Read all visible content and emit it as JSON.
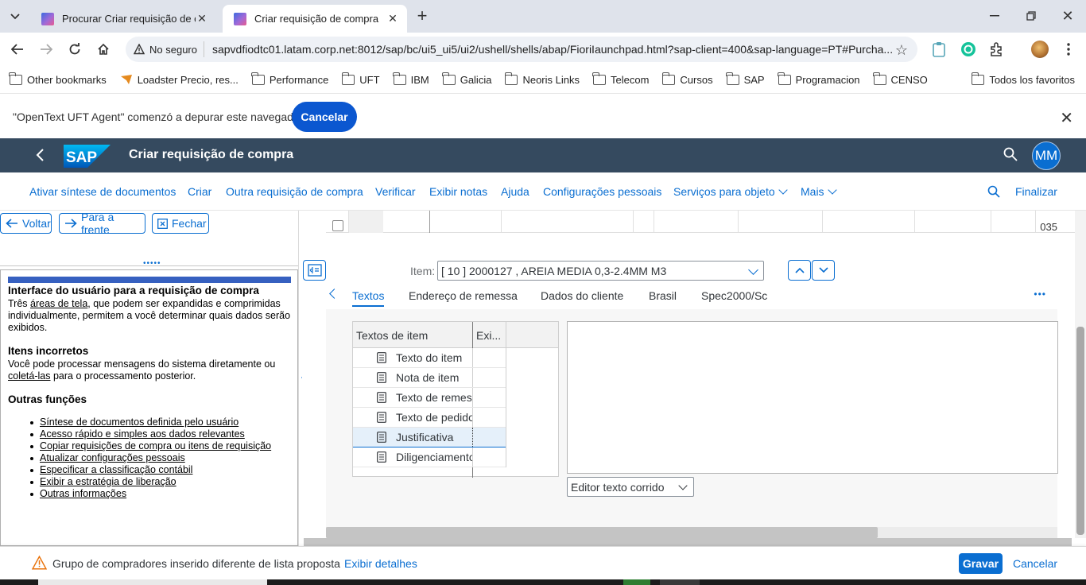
{
  "browser": {
    "tabs": [
      {
        "title": "Procurar Criar requisição de compra",
        "active": false
      },
      {
        "title": "Criar requisição de compra",
        "active": true
      }
    ],
    "security_label": "No seguro",
    "url": "sapvdfiodtc01.latam.corp.net:8012/sap/bc/ui5_ui5/ui2/ushell/shells/abap/FioriIaunchpad.html?sap-client=400&sap-language=PT#Purcha...",
    "bookmarks": [
      "Other bookmarks",
      "Loadster Precio, res...",
      "Performance",
      "UFT",
      "IBM",
      "Galicia",
      "Neoris Links",
      "Telecom",
      "Cursos",
      "SAP",
      "Programacion",
      "CENSO"
    ],
    "bookmarks_right": "Todos los favoritos",
    "infobar": {
      "message": "\"OpenText UFT Agent\" comenzó a depurar este navegador",
      "cancel_label": "Cancelar"
    }
  },
  "shell": {
    "title": "Criar requisição de compra",
    "avatar_initials": "MM",
    "brand_color": "#354a5f"
  },
  "toolbar": {
    "items": [
      "Ativar síntese de documentos",
      "Criar",
      "Outra requisição de compra",
      "Verificar",
      "Exibir notas",
      "Ajuda",
      "Configurações pessoais",
      "Serviços para objeto",
      "Mais"
    ],
    "finalize_label": "Finalizar"
  },
  "help_nav": {
    "back_label": "Voltar",
    "forward_label": "Para a frente",
    "close_label": "Fechar"
  },
  "help": {
    "section1_title": "Interface do usuário para a requisição de compra",
    "section1_pre": "Três ",
    "section1_link": "áreas de tela",
    "section1_post": ", que podem ser expandidas e comprimidas individualmente, permitem a você determinar quais dados serão exibidos.",
    "section2_title": "Itens incorretos",
    "section2_pre": "Você pode processar mensagens do sistema diretamente ou ",
    "section2_link": "coletá-las",
    "section2_post": " para o processamento posterior.",
    "section3_title": "Outras funções",
    "links": [
      "Síntese de documentos definida pelo usuário",
      "Acesso rápido e simples aos dados relevantes",
      "Copiar requisições de compra ou itens de requisição",
      "Atualizar configurações pessoais",
      "Especificar a classificação contábil",
      "Exibir a estratégia de liberação",
      "Outras informações"
    ]
  },
  "grid": {
    "visible_row_number": "035"
  },
  "item": {
    "label": "Item:",
    "selected": "[ 10 ] 2000127 , AREIA MEDIA 0,3-2.4MM M3"
  },
  "detail_tabs": [
    "Textos",
    "Endereço de remessa",
    "Dados do cliente",
    "Brasil",
    "Spec2000/Sc"
  ],
  "texts_table": {
    "col1": "Textos de item",
    "col2": "Exi...",
    "rows": [
      "Texto do item",
      "Nota de item",
      "Texto de remessa",
      "Texto de pedido",
      "Justificativa",
      "Diligenciamento"
    ],
    "selected_row": "Justificativa"
  },
  "editor_mode": "Editor texto corrido",
  "footer": {
    "message": "Grupo de compradores inserido diferente de lista proposta",
    "details_label": "Exibir detalhes",
    "save_label": "Gravar",
    "cancel_label": "Cancelar"
  },
  "colors": {
    "accent": "#0a6ed1",
    "chrome_accent": "#0b57d0",
    "warning": "#e9730c"
  }
}
